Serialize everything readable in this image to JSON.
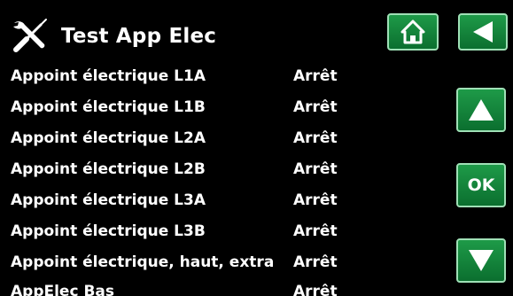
{
  "header": {
    "title": "Test App Elec",
    "title_icon": "tools-icon"
  },
  "nav": {
    "home_icon": "home-icon",
    "back_icon": "back-arrow-icon",
    "up_icon": "arrow-up-icon",
    "ok_label": "OK",
    "down_icon": "arrow-down-icon"
  },
  "rows": [
    {
      "label": "Appoint électrique L1A",
      "value": "Arrêt"
    },
    {
      "label": "Appoint électrique L1B",
      "value": "Arrêt"
    },
    {
      "label": "Appoint électrique L2A",
      "value": "Arrêt"
    },
    {
      "label": "Appoint électrique L2B",
      "value": "Arrêt"
    },
    {
      "label": "Appoint électrique L3A",
      "value": "Arrêt"
    },
    {
      "label": "Appoint électrique L3B",
      "value": "Arrêt"
    },
    {
      "label": "Appoint électrique, haut, extra",
      "value": "Arrêt"
    },
    {
      "label": "AppElec Bas",
      "value": "Arrêt"
    }
  ],
  "colors": {
    "background": "#000000",
    "button_green": "#14873c",
    "button_border": "#9fe0b6",
    "text": "#ffffff"
  }
}
